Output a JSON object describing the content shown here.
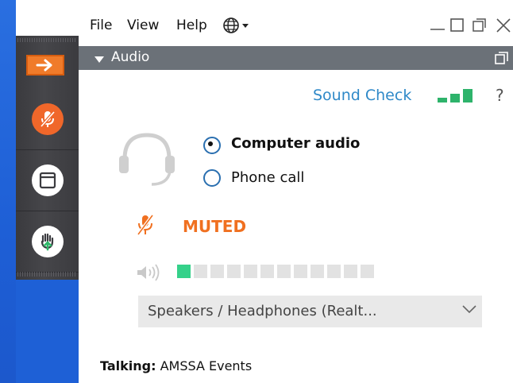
{
  "menu": {
    "file": "File",
    "view": "View",
    "help": "Help"
  },
  "icons": {
    "globe": "globe-icon",
    "minimize": "minimize-icon",
    "maximize": "maximize-icon",
    "restore": "restore-icon",
    "close": "close-icon",
    "headset": "headset-icon",
    "mic_muted": "mic-muted-icon",
    "speaker": "speaker-icon"
  },
  "panel": {
    "title": "Audio"
  },
  "sound_check": {
    "label": "Sound Check",
    "help": "?"
  },
  "audio_options": {
    "computer_audio": "Computer audio",
    "phone_call": "Phone call",
    "selected": "Computer audio"
  },
  "mute_status": "MUTED",
  "output_level": {
    "segments_total": 12,
    "segments_on": 1
  },
  "speaker_select": {
    "value": "Speakers / Headphones (Realt..."
  },
  "talking": {
    "label": "Talking:",
    "name": "AMSSA Events"
  },
  "colors": {
    "accent_orange": "#f07b2a",
    "link_blue": "#2f89c8",
    "level_green": "#35d18a",
    "header_gray": "#6b7178"
  }
}
